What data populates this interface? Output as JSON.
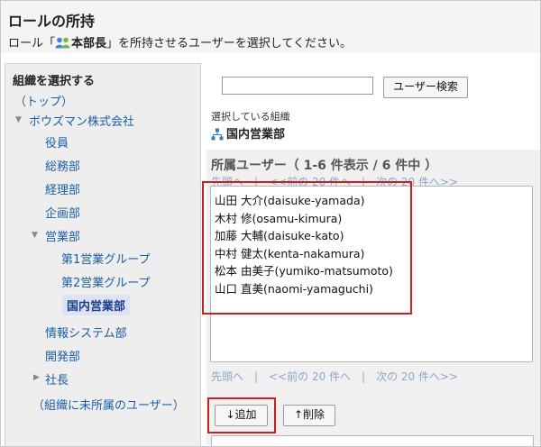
{
  "header": {
    "title": "ロールの所持",
    "desc_prefix": "ロール「",
    "role_name": "本部長",
    "desc_suffix": "」を所持させるユーザーを選択してください。"
  },
  "org_tree": {
    "title": "組織を選択する",
    "top": "（トップ）",
    "company": "ボウズマン株式会社",
    "items": [
      "役員",
      "総務部",
      "経理部",
      "企画部"
    ],
    "sales": "営業部",
    "sales_children": [
      "第1営業グループ",
      "第2営業グループ",
      "国内営業部"
    ],
    "items_after": [
      "情報システム部",
      "開発部"
    ],
    "president": "社長",
    "unassigned": "（組織に未所属のユーザー）"
  },
  "search": {
    "value": "",
    "button_label": "ユーザー検索"
  },
  "selected_org": {
    "label": "選択している組織",
    "name": "国内営業部"
  },
  "users": {
    "heading": "所属ユーザー（ 1-6 件表示 / 6 件中 ）",
    "pager": "先頭へ　|　<<前の 20 件へ　|　次の 20 件へ>>",
    "list": [
      "山田 大介(daisuke-yamada)",
      "木村 修(osamu-kimura)",
      "加藤 大輔(daisuke-kato)",
      "中村 健太(kenta-nakamura)",
      "松本 由美子(yumiko-matsumoto)",
      "山口 直美(naomi-yamaguchi)"
    ]
  },
  "actions": {
    "add_label": "↓追加",
    "remove_label": "↑削除"
  },
  "colors": {
    "link": "#1a5fa8",
    "highlight_border": "#cc2020",
    "selected_bg": "#dde3f4"
  }
}
